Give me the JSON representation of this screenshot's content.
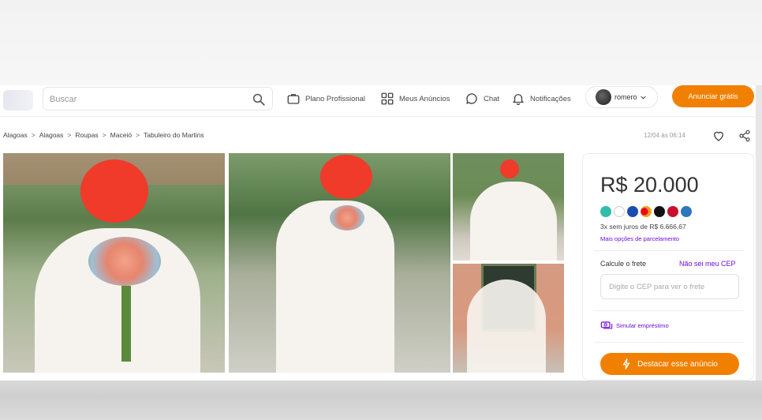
{
  "header": {
    "search_placeholder": "Buscar",
    "nav": {
      "plano": "Plano Profissional",
      "anuncios": "Meus Anúncios",
      "chat": "Chat",
      "notificacoes": "Notificações"
    },
    "user_name": "romero",
    "cta_label": "Anunciar grátis"
  },
  "breadcrumb": {
    "items": [
      "Alagoas",
      "Alagoas",
      "Roupas",
      "Maceió",
      "Tabuleiro do Martins"
    ],
    "separator": ">"
  },
  "listing": {
    "date": "12/04 às 06:14",
    "price": "R$ 20.000",
    "installment": "3x sem juros de R$ 6.666,67",
    "more_installments": "Mais opções de parcelamento",
    "frete_label": "Calcule o frete",
    "cep_link": "Não sei meu CEP",
    "cep_placeholder": "Digite o CEP para ver o frete",
    "loan_label": "Simular empréstimo",
    "highlight_cta": "Destacar esse anúncio"
  },
  "colors": {
    "accent_orange": "#f28000",
    "link_purple": "#6d0ad6",
    "censor_red": "#f03a2a"
  },
  "payment_icons": [
    {
      "name": "pix-icon",
      "color": "#32bcad"
    },
    {
      "name": "nubank-icon",
      "color": "#ffffff"
    },
    {
      "name": "visa-icon",
      "color": "#1a4db3"
    },
    {
      "name": "mastercard-icon",
      "color": "#222222"
    },
    {
      "name": "elo-icon",
      "color": "#111111"
    },
    {
      "name": "hipercard-icon",
      "color": "#c8102e"
    },
    {
      "name": "amex-icon",
      "color": "#2e77bc"
    }
  ]
}
